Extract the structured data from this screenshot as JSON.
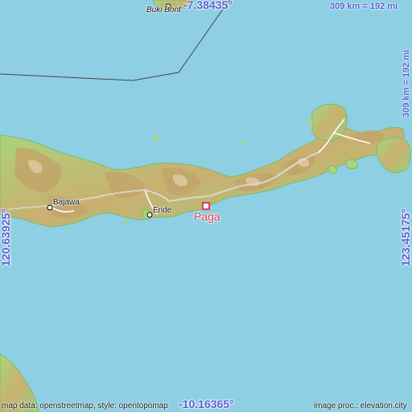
{
  "coords": {
    "top": "-7.38435°",
    "bottom": "-10.16365°",
    "left": "120.63925°",
    "right": "123.45175°"
  },
  "scale": {
    "top": "309 km = 192 mi",
    "right": "309 km = 192 mi"
  },
  "places": {
    "target": "Paga",
    "bajawa": "Bajawa",
    "ende": "Ende",
    "buki_bont": "Buki Bont"
  },
  "credits": {
    "left": "map data: openstreetmap, style: opentopomap",
    "right": "image proc.: elevation.city"
  },
  "colors": {
    "sea": "#8ecfe3",
    "lowland": "#9bd17a",
    "highland": "#c6ac6e",
    "peak": "#d4c294",
    "label": "#5a5fd6",
    "marker": "#e23c55"
  }
}
